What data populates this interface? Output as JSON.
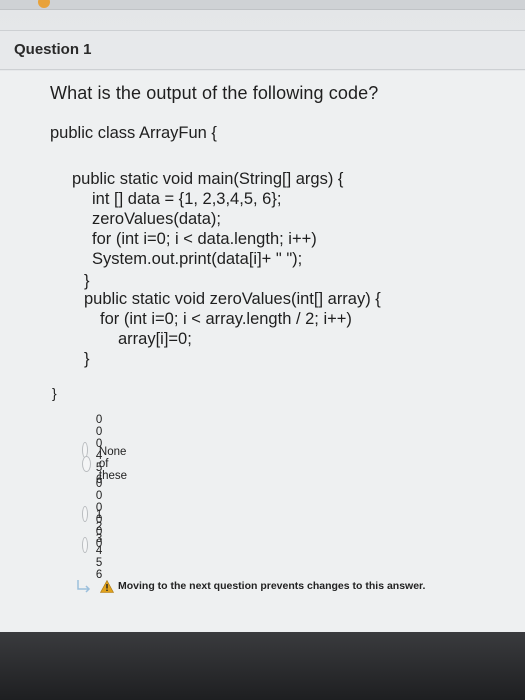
{
  "question": {
    "title": "Question 1",
    "text": "What is the output of the following code?"
  },
  "code": {
    "lines": [
      "public class ArrayFun {",
      "public static void main(String[] args) {",
      "int [] data = {1, 2,3,4,5, 6};",
      "zeroValues(data);",
      "for (int i=0; i < data.length; i++)",
      "System.out.print(data[i]+ \" \");",
      "}",
      "public static void zeroValues(int[] array) {",
      "for (int i=0; i < array.length / 2; i++)",
      "array[i]=0;",
      "}",
      "}"
    ]
  },
  "options": [
    {
      "label": "0 0 0 4 5 6",
      "selected": false
    },
    {
      "label": "None of these",
      "selected": false
    },
    {
      "label": "0 0 0 0 0 0",
      "selected": false
    },
    {
      "label": "1 2 3 4 5 6",
      "selected": false
    }
  ],
  "warning": {
    "text": "Moving to the next question prevents changes to this answer.",
    "icon": "warning-triangle-icon",
    "color": "#e0a21c"
  },
  "colors": {
    "accent": "#e0a21c",
    "arrow": "#9bbfdc"
  }
}
